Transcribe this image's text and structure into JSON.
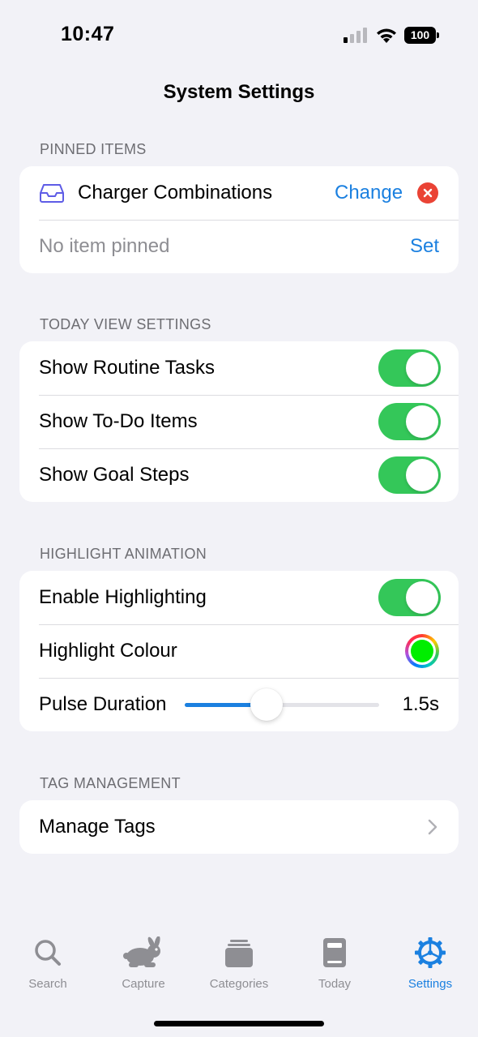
{
  "status_bar": {
    "time": "10:47",
    "battery": "100",
    "signal_icon": "cellular-signal-icon",
    "wifi_icon": "wifi-icon"
  },
  "page_title": "System Settings",
  "colors": {
    "accent": "#1b80e0",
    "toggle_on": "#34c759",
    "clear": "#ea4335",
    "highlight_colour": "#00ee00",
    "background": "#f2f2f7"
  },
  "pinned": {
    "header": "PINNED ITEMS",
    "item_icon": "inbox-tray-icon",
    "item_name": "Charger Combinations",
    "change_label": "Change",
    "empty_label": "No item pinned",
    "set_label": "Set"
  },
  "today_view": {
    "header": "TODAY VIEW SETTINGS",
    "rows": [
      {
        "label": "Show Routine Tasks",
        "on": true
      },
      {
        "label": "Show To-Do Items",
        "on": true
      },
      {
        "label": "Show Goal Steps",
        "on": true
      }
    ]
  },
  "highlight": {
    "header": "HIGHLIGHT ANIMATION",
    "enable_label": "Enable Highlighting",
    "enable_on": true,
    "colour_label": "Highlight Colour",
    "pulse_label": "Pulse Duration",
    "pulse_fraction": 0.42,
    "pulse_value": "1.5s"
  },
  "tags": {
    "header": "TAG MANAGEMENT",
    "manage_label": "Manage Tags"
  },
  "tab_bar": {
    "tabs": [
      {
        "label": "Search",
        "icon": "magnifier-icon",
        "active": false
      },
      {
        "label": "Capture",
        "icon": "rabbit-icon",
        "active": false
      },
      {
        "label": "Categories",
        "icon": "stacked-cards-icon",
        "active": false
      },
      {
        "label": "Today",
        "icon": "book-icon",
        "active": false
      },
      {
        "label": "Settings",
        "icon": "gear-icon",
        "active": true
      }
    ]
  }
}
